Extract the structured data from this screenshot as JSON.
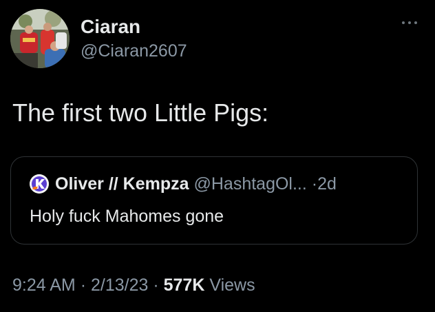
{
  "tweet": {
    "author": {
      "display_name": "Ciaran",
      "handle": "@Ciaran2607",
      "avatar_icon": "profile-photo-crowd"
    },
    "more_icon": "more-horizontal-icon",
    "text": "The first two Little Pigs:",
    "quoted_tweet": {
      "display_name": "Oliver // Kempza",
      "handle": "@HashtagOl...",
      "separator": "·",
      "time": "2d",
      "text": "Holy fuck Mahomes gone",
      "avatar_icon": "k-logo-avatar"
    },
    "meta": {
      "time": "9:24 AM",
      "sep1": "·",
      "date": "2/13/23",
      "sep2": "·",
      "views_count": "577K",
      "views_label": "Views"
    }
  },
  "colors": {
    "background": "#000000",
    "primary_text": "#e7e9ea",
    "secondary_text": "#8b98a5",
    "border": "#2f3336"
  }
}
